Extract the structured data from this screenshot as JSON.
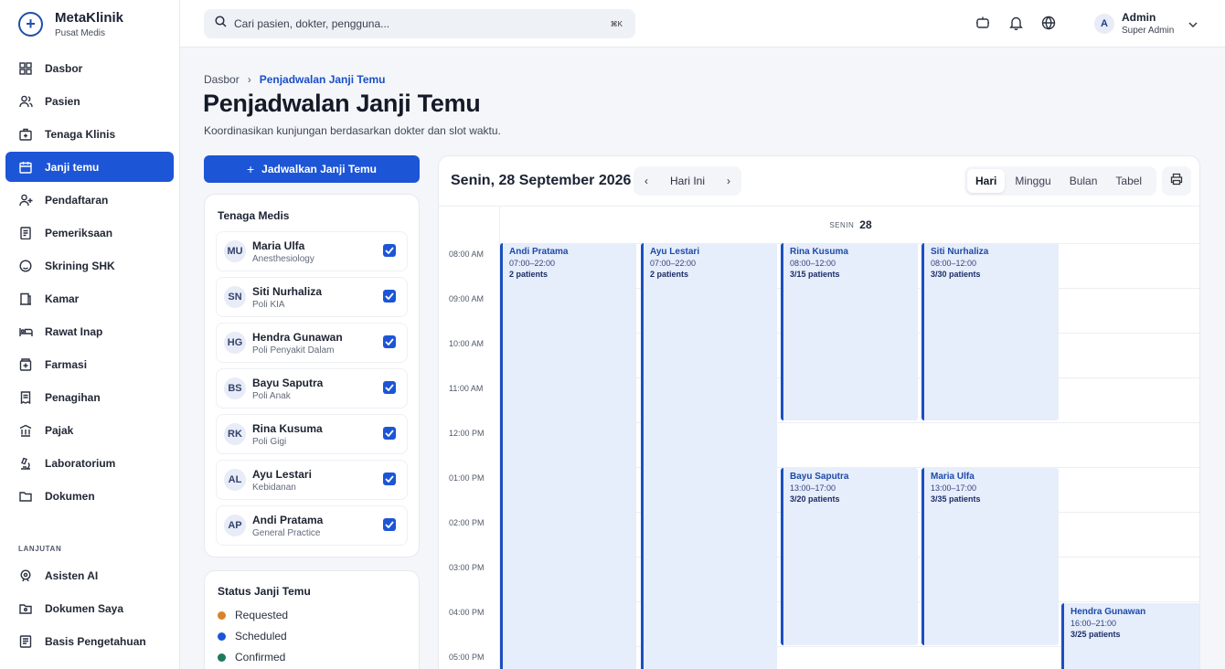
{
  "brand": {
    "name": "MetaKlinik",
    "subtitle": "Pusat Medis",
    "logo_icon": "plus-circle-icon"
  },
  "sidebar": {
    "items": [
      {
        "label": "Dasbor",
        "icon": "dashboard-icon"
      },
      {
        "label": "Pasien",
        "icon": "users-icon"
      },
      {
        "label": "Tenaga Klinis",
        "icon": "medical-bag-icon"
      },
      {
        "label": "Janji temu",
        "icon": "calendar-icon",
        "active": true
      },
      {
        "label": "Pendaftaran",
        "icon": "user-plus-icon"
      },
      {
        "label": "Pemeriksaan",
        "icon": "clipboard-icon"
      },
      {
        "label": "Skrining SHK",
        "icon": "screening-icon"
      },
      {
        "label": "Kamar",
        "icon": "room-icon"
      },
      {
        "label": "Rawat Inap",
        "icon": "bed-icon"
      },
      {
        "label": "Farmasi",
        "icon": "pharmacy-icon"
      },
      {
        "label": "Penagihan",
        "icon": "billing-icon"
      },
      {
        "label": "Pajak",
        "icon": "tax-icon"
      },
      {
        "label": "Laboratorium",
        "icon": "microscope-icon"
      },
      {
        "label": "Dokumen",
        "icon": "folder-icon"
      }
    ],
    "section_label": "LANJUTAN",
    "advanced_items": [
      {
        "label": "Asisten AI",
        "icon": "ai-assistant-icon"
      },
      {
        "label": "Dokumen Saya",
        "icon": "my-documents-icon"
      },
      {
        "label": "Basis Pengetahuan",
        "icon": "knowledge-base-icon"
      }
    ]
  },
  "topbar": {
    "search_placeholder": "Cari pasien, dokter, pengguna...",
    "shortcut": "⌘K",
    "user": {
      "initial": "A",
      "name": "Admin",
      "role": "Super Admin"
    }
  },
  "breadcrumb": {
    "home": "Dasbor",
    "separator": "›",
    "current": "Penjadwalan Janji Temu"
  },
  "page": {
    "title": "Penjadwalan Janji Temu",
    "subtitle": "Koordinasikan kunjungan berdasarkan dokter dan slot waktu.",
    "schedule_button": "Jadwalkan Janji Temu"
  },
  "medical_staff": {
    "title": "Tenaga Medis",
    "doctors": [
      {
        "initials": "MU",
        "name": "Maria Ulfa",
        "specialty": "Anesthesiology",
        "checked": true
      },
      {
        "initials": "SN",
        "name": "Siti Nurhaliza",
        "specialty": "Poli KIA",
        "checked": true
      },
      {
        "initials": "HG",
        "name": "Hendra Gunawan",
        "specialty": "Poli Penyakit Dalam",
        "checked": true
      },
      {
        "initials": "BS",
        "name": "Bayu Saputra",
        "specialty": "Poli Anak",
        "checked": true
      },
      {
        "initials": "RK",
        "name": "Rina Kusuma",
        "specialty": "Poli Gigi",
        "checked": true
      },
      {
        "initials": "AL",
        "name": "Ayu Lestari",
        "specialty": "Kebidanan",
        "checked": true
      },
      {
        "initials": "AP",
        "name": "Andi Pratama",
        "specialty": "General Practice",
        "checked": true
      }
    ]
  },
  "status_legend": {
    "title": "Status Janji Temu",
    "items": [
      {
        "label": "Requested",
        "color": "#d9822b"
      },
      {
        "label": "Scheduled",
        "color": "#1c55d6"
      },
      {
        "label": "Confirmed",
        "color": "#1e7a5f"
      }
    ]
  },
  "calendar": {
    "date_label": "Senin, 28 September 2026",
    "today_label": "Hari Ini",
    "prev": "‹",
    "next": "›",
    "views": [
      "Hari",
      "Minggu",
      "Bulan",
      "Tabel"
    ],
    "active_view": "Hari",
    "day_name": "SENIN",
    "day_number": "28",
    "time_labels": [
      "08:00 AM",
      "09:00 AM",
      "10:00 AM",
      "11:00 AM",
      "12:00 PM",
      "01:00 PM",
      "02:00 PM",
      "03:00 PM",
      "04:00 PM",
      "05:00 PM"
    ],
    "events": [
      {
        "name": "Andi Pratama",
        "time": "07:00–22:00",
        "patients": "2 patients"
      },
      {
        "name": "Ayu Lestari",
        "time": "07:00–22:00",
        "patients": "2 patients"
      },
      {
        "name": "Rina Kusuma",
        "time": "08:00–12:00",
        "patients": "3/15 patients"
      },
      {
        "name": "Siti Nurhaliza",
        "time": "08:00–12:00",
        "patients": "3/30 patients"
      },
      {
        "name": "Bayu Saputra",
        "time": "13:00–17:00",
        "patients": "3/20 patients"
      },
      {
        "name": "Maria Ulfa",
        "time": "13:00–17:00",
        "patients": "3/35 patients"
      },
      {
        "name": "Hendra Gunawan",
        "time": "16:00–21:00",
        "patients": "3/25 patients"
      }
    ]
  },
  "colors": {
    "accent": "#1c55d6",
    "event_bg": "#e6edfb",
    "event_border": "#1c4fbf"
  }
}
